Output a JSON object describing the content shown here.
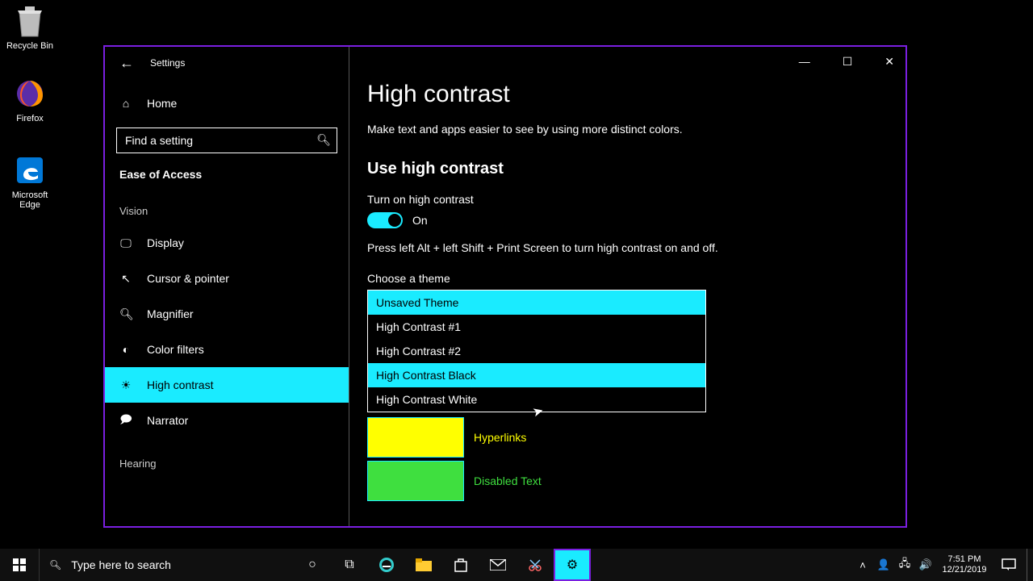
{
  "desktop": {
    "icons": [
      {
        "label": "Recycle Bin"
      },
      {
        "label": "Firefox"
      },
      {
        "label": "Microsoft Edge"
      }
    ]
  },
  "window": {
    "app_title": "Settings",
    "controls": {
      "min": "—",
      "max": "☐",
      "close": "✕"
    },
    "sidebar": {
      "home": "Home",
      "search_placeholder": "Find a setting",
      "category": "Ease of Access",
      "subhead_vision": "Vision",
      "items": [
        {
          "label": "Display"
        },
        {
          "label": "Cursor & pointer"
        },
        {
          "label": "Magnifier"
        },
        {
          "label": "Color filters"
        },
        {
          "label": "High contrast"
        },
        {
          "label": "Narrator"
        }
      ],
      "subhead_hearing": "Hearing"
    },
    "main": {
      "title": "High contrast",
      "subtitle": "Make text and apps easier to see by using more distinct colors.",
      "section": "Use high contrast",
      "toggle_label": "Turn on high contrast",
      "toggle_state": "On",
      "shortcut_hint": "Press left Alt + left Shift + Print Screen to turn high contrast on and off.",
      "choose_label": "Choose a theme",
      "themes": [
        "Unsaved Theme",
        "High Contrast #1",
        "High Contrast #2",
        "High Contrast Black",
        "High Contrast White"
      ],
      "color_labels": {
        "hyperlinks": "Hyperlinks",
        "disabled": "Disabled Text"
      }
    }
  },
  "taskbar": {
    "search_placeholder": "Type here to search",
    "clock_time": "7:51 PM",
    "clock_date": "12/21/2019"
  }
}
